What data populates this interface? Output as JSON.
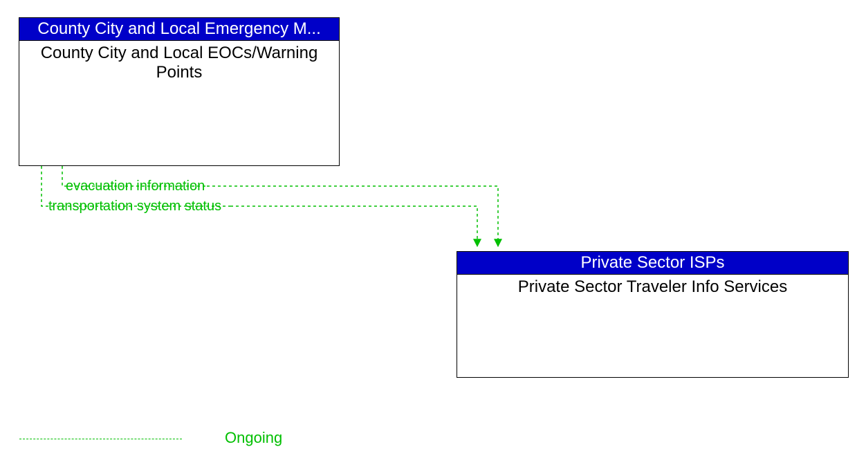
{
  "nodes": {
    "top": {
      "header": "County City and Local Emergency M...",
      "body": "County City and Local EOCs/Warning Points"
    },
    "bottom": {
      "header": "Private Sector ISPs",
      "body": "Private Sector Traveler Info Services"
    }
  },
  "flows": {
    "flow1": "evacuation information",
    "flow2": "transportation system status"
  },
  "legend": {
    "ongoing": "Ongoing"
  },
  "colors": {
    "header_bg": "#0000c8",
    "flow_line": "#00bf00"
  }
}
